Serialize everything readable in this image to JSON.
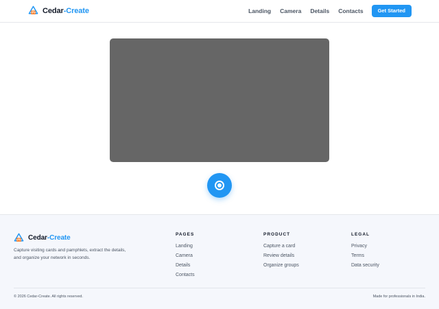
{
  "brand": {
    "name_part1": "Cedar",
    "name_part2": "-Create",
    "logo_icon": "house-triangle-icon",
    "accent_color": "#2196f3",
    "logo_secondary_color": "#f97316"
  },
  "header": {
    "nav": [
      {
        "label": "Landing"
      },
      {
        "label": "Camera"
      },
      {
        "label": "Details"
      },
      {
        "label": "Contacts"
      }
    ],
    "cta_label": "Get Started"
  },
  "camera": {
    "preview_color": "#666666",
    "shutter_icon": "shutter-icon"
  },
  "footer": {
    "description": "Capture visiting cards and pamphlets, extract the details, and organize your network in seconds.",
    "columns": [
      {
        "title": "PAGES",
        "links": [
          "Landing",
          "Camera",
          "Details",
          "Contacts"
        ]
      },
      {
        "title": "PRODUCT",
        "links": [
          "Capture a card",
          "Review details",
          "Organize groups"
        ]
      },
      {
        "title": "LEGAL",
        "links": [
          "Privacy",
          "Terms",
          "Data security"
        ]
      }
    ],
    "copyright": "© 2026 Cedar-Create. All rights reserved.",
    "made_in": "Made for professionals in India."
  }
}
